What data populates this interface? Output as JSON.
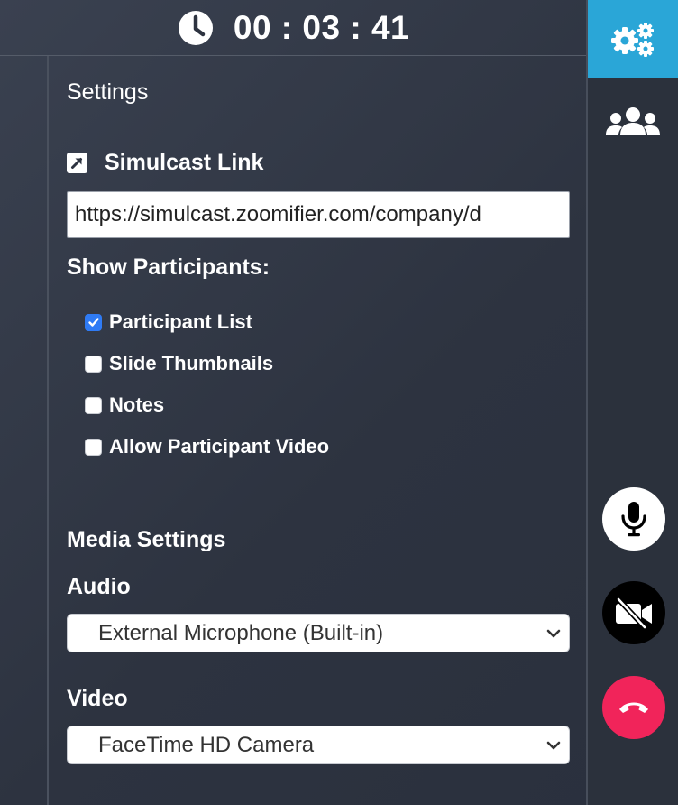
{
  "timer": {
    "elapsed": "00 : 03 : 41"
  },
  "settings": {
    "title": "Settings",
    "simulcast": {
      "label": "Simulcast Link",
      "url": "https://simulcast.zoomifier.com/company/d"
    },
    "show_participants": {
      "label": "Show Participants:",
      "options": [
        {
          "label": "Participant List",
          "checked": true
        },
        {
          "label": "Slide Thumbnails",
          "checked": false
        },
        {
          "label": "Notes",
          "checked": false
        },
        {
          "label": "Allow Participant Video",
          "checked": false
        }
      ]
    },
    "media": {
      "heading": "Media Settings",
      "audio_label": "Audio",
      "audio_value": "External Microphone (Built-in)",
      "video_label": "Video",
      "video_value": "FaceTime HD Camera"
    }
  },
  "colors": {
    "accent": "#2aa6d7",
    "hangup": "#f1245a",
    "checkbox_checked": "#2f7bf5"
  },
  "icons": {
    "timer": "clock-icon",
    "rail_settings": "gears-icon",
    "rail_participants": "users-icon",
    "microphone": "microphone-icon",
    "camera": "video-off-icon",
    "hangup": "phone-hangup-icon"
  }
}
